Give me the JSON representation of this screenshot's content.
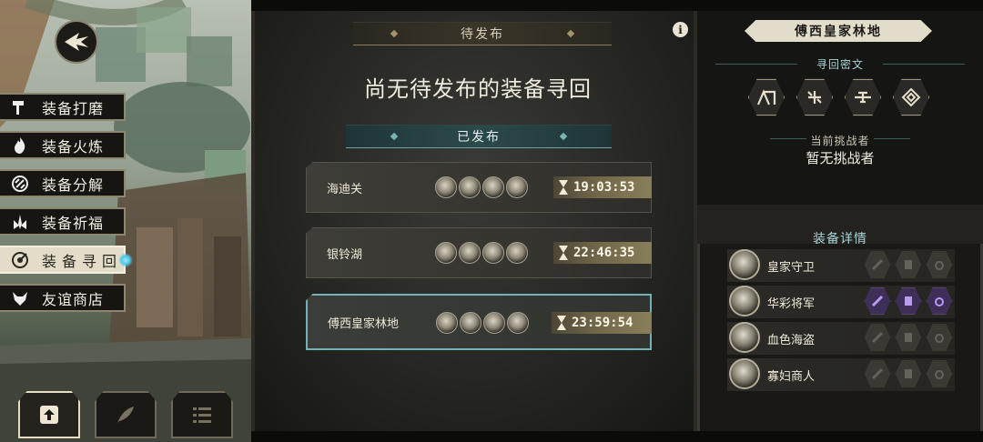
{
  "left_menu": {
    "items": [
      {
        "label": "装备打磨",
        "icon": "hammer-icon"
      },
      {
        "label": "装备火炼",
        "icon": "flame-icon"
      },
      {
        "label": "装备分解",
        "icon": "disassemble-icon"
      },
      {
        "label": "装备祈福",
        "icon": "bless-icon"
      },
      {
        "label": "装备寻回",
        "icon": "target-icon",
        "active": true
      },
      {
        "label": "友谊商店",
        "icon": "fox-icon"
      }
    ]
  },
  "bottom_buttons": [
    {
      "icon": "upload-icon",
      "active": true
    },
    {
      "icon": "feather-icon"
    },
    {
      "icon": "list-icon"
    }
  ],
  "middle": {
    "pending_header": "待发布",
    "no_pending_text": "尚无待发布的装备寻回",
    "published_header": "已发布",
    "info_icon": "i",
    "rows": [
      {
        "name": "海迪关",
        "time": "19:03:53"
      },
      {
        "name": "银铃湖",
        "time": "22:46:35"
      },
      {
        "name": "傅西皇家林地",
        "time": "23:59:54",
        "selected": true
      }
    ]
  },
  "right": {
    "location_title": "傅西皇家林地",
    "cipher_label": "寻回密文",
    "cipher_icons": [
      "arch-rune-icon",
      "cross-rune-icon",
      "key-rune-icon",
      "diamond-rune-icon"
    ],
    "challenger_label": "当前挑战者",
    "challenger_value": "暂无挑战者",
    "equip_label": "装备详情",
    "equipment": [
      {
        "name": "皇家守卫",
        "slots_on": false
      },
      {
        "name": "华彩将军",
        "slots_on": true
      },
      {
        "name": "血色海盗",
        "slots_on": false
      },
      {
        "name": "寡妇商人",
        "slots_on": false
      }
    ]
  },
  "colors": {
    "teal_accent": "#73b2b8",
    "gold_accent": "#a2916a",
    "active_menu": "#e2dcc9",
    "purple_slot": "#9b7fd6"
  }
}
